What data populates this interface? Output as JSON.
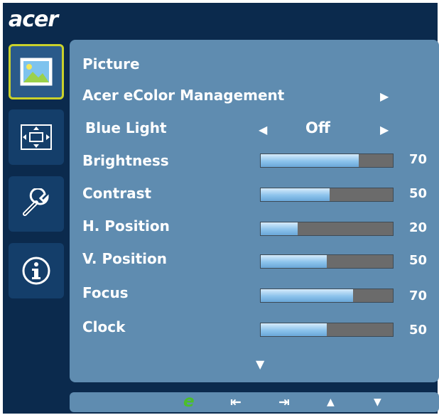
{
  "brand": {
    "logo": "acer"
  },
  "sidebar": {
    "items": [
      {
        "name": "picture",
        "icon": "picture-icon",
        "active": true
      },
      {
        "name": "osd-position",
        "icon": "position-icon",
        "active": false
      },
      {
        "name": "settings",
        "icon": "wrench-icon",
        "active": false
      },
      {
        "name": "information",
        "icon": "info-icon",
        "active": false
      }
    ]
  },
  "menu": {
    "title": "Picture",
    "ecolor": {
      "label": "Acer eColor Management",
      "arrow": "▶"
    },
    "blue_light": {
      "label": "Blue Light",
      "value": "Off",
      "left_arrow": "◀",
      "right_arrow": "▶"
    },
    "rows": [
      {
        "label": "Brightness",
        "value": "70",
        "level": 0.74
      },
      {
        "label": "Contrast",
        "value": "50",
        "level": 0.52
      },
      {
        "label": "H. Position",
        "value": "20",
        "level": 0.28
      },
      {
        "label": "V. Position",
        "value": "50",
        "level": 0.5
      },
      {
        "label": "Focus",
        "value": "70",
        "level": 0.7
      },
      {
        "label": "Clock",
        "value": "50",
        "level": 0.5
      }
    ],
    "scroll_down": "▼"
  },
  "bottom_bar": {
    "e_key": "e",
    "exit_key": "⇤",
    "enter_key": "⇥",
    "up_key": "▲",
    "down_key": "▼"
  },
  "colors": {
    "frame": "#0b2a4d",
    "panel": "#5f8cb0",
    "active_border": "#c9d12a",
    "bar_fill": "#8cc3ec",
    "bar_empty": "#6b6b6b"
  }
}
